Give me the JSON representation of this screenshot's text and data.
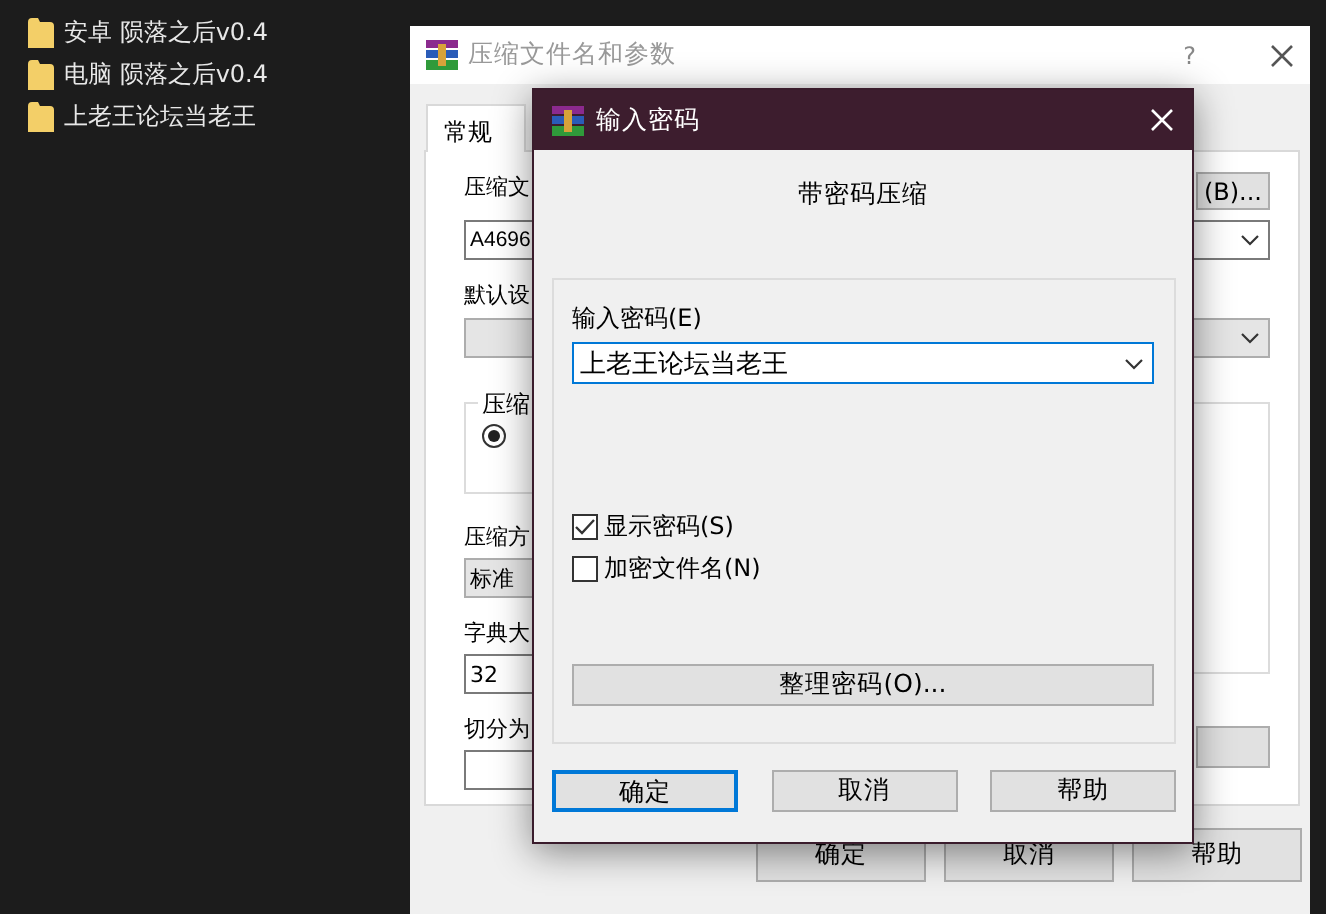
{
  "desktop": {
    "files": [
      {
        "name": "安卓 陨落之后v0.4"
      },
      {
        "name": "电脑 陨落之后v0.4"
      },
      {
        "name": "上老王论坛当老王"
      }
    ]
  },
  "archive_window": {
    "title": "压缩文件名和参数",
    "help": "?",
    "tabs": [
      {
        "label": "常规",
        "selected": true
      }
    ],
    "browse_button": "(B)...",
    "filename_label": "压缩文",
    "filename_value": "A4696",
    "profile_label": "默认设",
    "group_title": "压缩",
    "radio": {
      "selected": true
    },
    "fields": [
      {
        "kind": "combo",
        "label": "压缩方",
        "value": "标准"
      },
      {
        "kind": "input",
        "label": "字典大",
        "value": "32"
      },
      {
        "kind": "input",
        "label": "切分为"
      }
    ],
    "buttons": [
      "确定",
      "取消",
      "帮助"
    ]
  },
  "dialog": {
    "title": "输入密码",
    "heading": "带密码压缩",
    "password_label": "输入密码(E)",
    "password_value": "上老王论坛当老王",
    "checkboxes": [
      {
        "label": "显示密码(S)",
        "checked": true
      },
      {
        "label": "加密文件名(N)",
        "checked": false
      }
    ],
    "manage_button": "整理密码(O)...",
    "buttons": [
      {
        "label": "确定",
        "default": true
      },
      {
        "label": "取消",
        "default": false
      },
      {
        "label": "帮助",
        "default": false
      }
    ]
  }
}
